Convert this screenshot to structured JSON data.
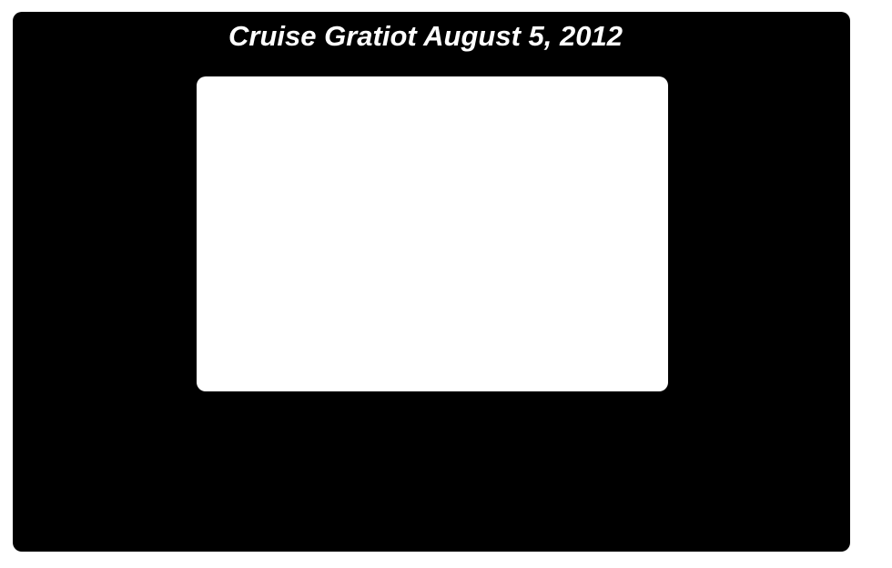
{
  "header": {
    "title": "Cruise Gratiot August 5, 2012"
  },
  "colors": {
    "frame": "#000000",
    "title_text": "#ffffff",
    "photo_window": "#ffffff",
    "page_background": "#ffffff"
  }
}
